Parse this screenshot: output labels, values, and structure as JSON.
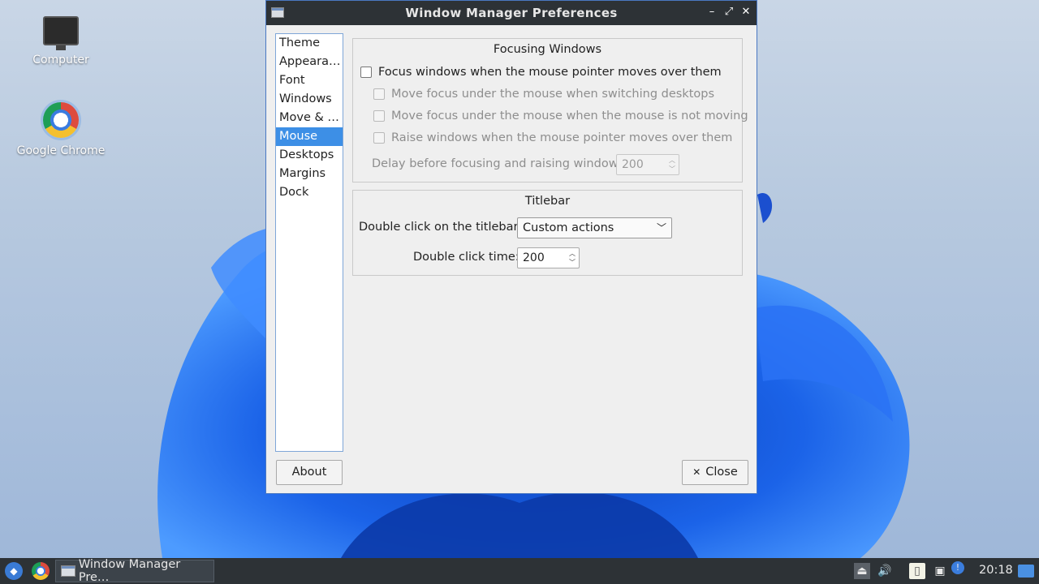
{
  "desktop": {
    "icons": [
      {
        "label": "Computer",
        "icon": "computer-icon"
      },
      {
        "label": "Google Chrome",
        "icon": "chrome-icon"
      }
    ]
  },
  "window": {
    "title": "Window Manager Preferences",
    "controls": {
      "minimize": "–",
      "maximize": "⤢",
      "close": "✕"
    },
    "sidebar": {
      "items": [
        "Theme",
        "Appeara…",
        "Font",
        "Windows",
        "Move & …",
        "Mouse",
        "Desktops",
        "Margins",
        "Dock"
      ],
      "selected": "Mouse"
    },
    "focusing": {
      "title": "Focusing Windows",
      "focus_follows_mouse": {
        "label": "Focus windows when the mouse pointer moves over them",
        "checked": false
      },
      "move_focus_switching": {
        "label": "Move focus under the mouse when switching desktops",
        "checked": false
      },
      "move_focus_not_moving": {
        "label": "Move focus under the mouse when the mouse is not moving",
        "checked": false
      },
      "raise_on_hover": {
        "label": "Raise windows when the mouse pointer moves over them",
        "checked": false
      },
      "delay_label": "Delay before focusing and raising windows:",
      "delay_value": "200"
    },
    "titlebar": {
      "title": "Titlebar",
      "double_click_label": "Double click on the titlebar:",
      "double_click_value": "Custom actions",
      "double_click_time_label": "Double click time:",
      "double_click_time_value": "200"
    },
    "buttons": {
      "about": "About",
      "close": "Close",
      "close_icon": "✕"
    }
  },
  "taskbar": {
    "task_label": "Window Manager Pre…",
    "clock": "20:18"
  },
  "colors": {
    "accent": "#3d8fe6",
    "titlebar": "#2d3236",
    "window_border": "#4a78c2"
  }
}
